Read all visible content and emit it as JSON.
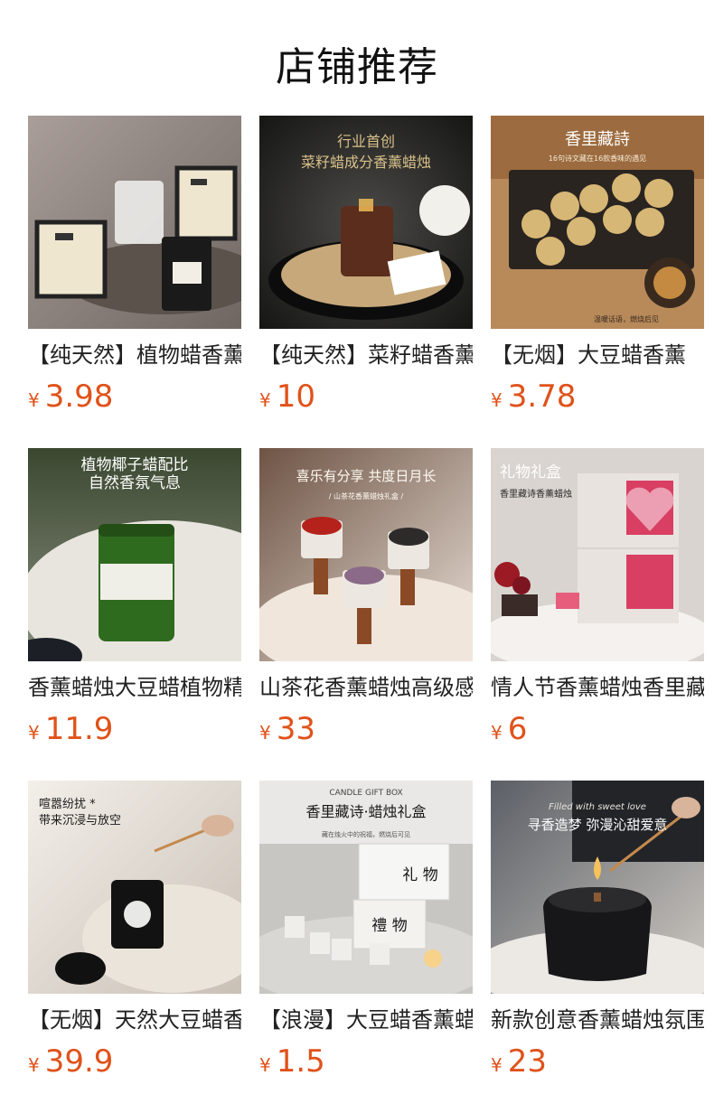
{
  "page": {
    "title": "店铺推荐"
  },
  "currency_symbol": "¥",
  "products": [
    {
      "name": "【纯天然】植物蜡香薰",
      "price": "3.98",
      "image_text": []
    },
    {
      "name": "【纯天然】菜籽蜡香薰",
      "price": "10",
      "image_text": [
        "行业首创",
        "菜籽蜡成分香薰蜡烛"
      ]
    },
    {
      "name": "【无烟】大豆蜡香薰",
      "price": "3.78",
      "image_text": [
        "香里藏詩",
        "16句诗文藏在16款香味的遇见",
        "温暖话语，燃烧后见"
      ]
    },
    {
      "name": "香薰蜡烛大豆蜡植物精油",
      "price": "11.9",
      "image_text": [
        "植物椰子蜡配比",
        "自然香氛气息"
      ]
    },
    {
      "name": "山茶花香薰蜡烛高级感",
      "price": "33",
      "image_text": [
        "喜乐有分享 共度日月长",
        "/ 山茶花香薰蜡烛礼盒 /"
      ]
    },
    {
      "name": "情人节香薰蜡烛香里藏诗",
      "price": "6",
      "image_text": [
        "礼物礼盒",
        "香里藏诗香薰蜡烛"
      ]
    },
    {
      "name": "【无烟】天然大豆蜡香薰",
      "price": "39.9",
      "image_text": [
        "喧嚣纷扰 *",
        "带来沉浸与放空"
      ]
    },
    {
      "name": "【浪漫】大豆蜡香薰蜡烛",
      "price": "1.5",
      "image_text": [
        "CANDLE GIFT BOX",
        "香里藏诗·蜡烛礼盒",
        "藏在烛火中的祝福，燃烧后可见",
        "礼 物",
        "禮 物"
      ]
    },
    {
      "name": "新款创意香薰蜡烛氛围",
      "price": "23",
      "image_text": [
        "Filled with sweet love",
        "寻香造梦 弥漫沁甜爱意"
      ]
    }
  ],
  "colors": {
    "price": "#e0521a",
    "title": "#111111",
    "text": "#222222"
  }
}
